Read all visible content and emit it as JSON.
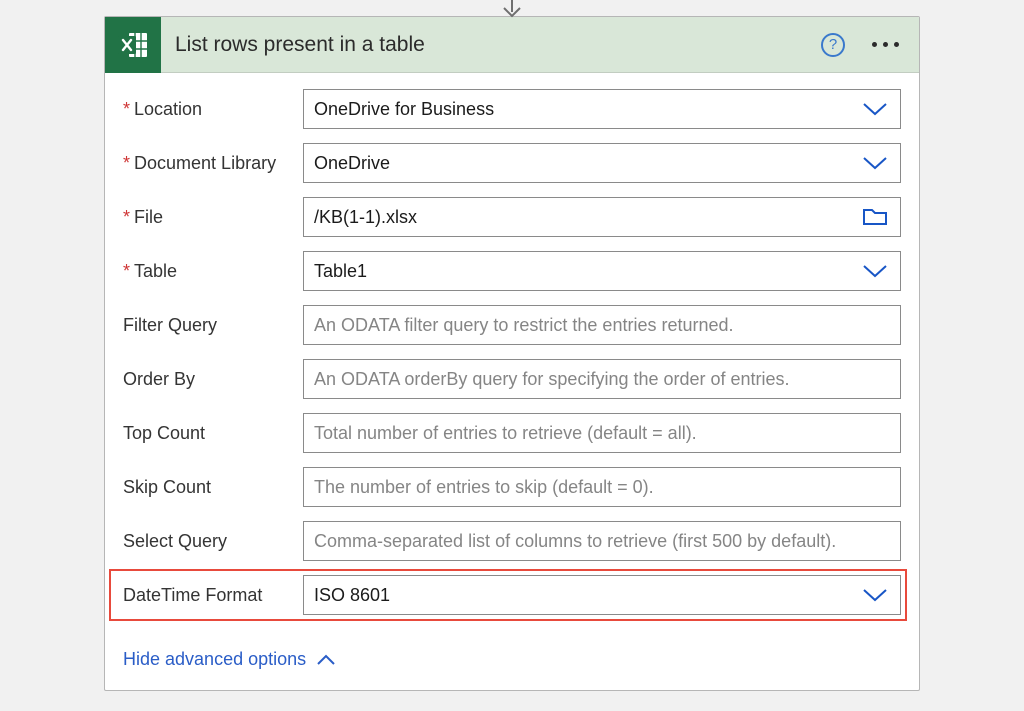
{
  "header": {
    "title": "List rows present in a table"
  },
  "fields": {
    "location": {
      "label": "Location",
      "value": "OneDrive for Business"
    },
    "documentLibrary": {
      "label": "Document Library",
      "value": "OneDrive"
    },
    "file": {
      "label": "File",
      "value": "/KB(1-1).xlsx"
    },
    "table": {
      "label": "Table",
      "value": "Table1"
    },
    "filterQuery": {
      "label": "Filter Query",
      "value": "",
      "placeholder": "An ODATA filter query to restrict the entries returned."
    },
    "orderBy": {
      "label": "Order By",
      "value": "",
      "placeholder": "An ODATA orderBy query for specifying the order of entries."
    },
    "topCount": {
      "label": "Top Count",
      "value": "",
      "placeholder": "Total number of entries to retrieve (default = all)."
    },
    "skipCount": {
      "label": "Skip Count",
      "value": "",
      "placeholder": "The number of entries to skip (default = 0)."
    },
    "selectQuery": {
      "label": "Select Query",
      "value": "",
      "placeholder": "Comma-separated list of columns to retrieve (first 500 by default)."
    },
    "dateTimeFormat": {
      "label": "DateTime Format",
      "value": "ISO 8601"
    }
  },
  "footer": {
    "toggleText": "Hide advanced options"
  }
}
